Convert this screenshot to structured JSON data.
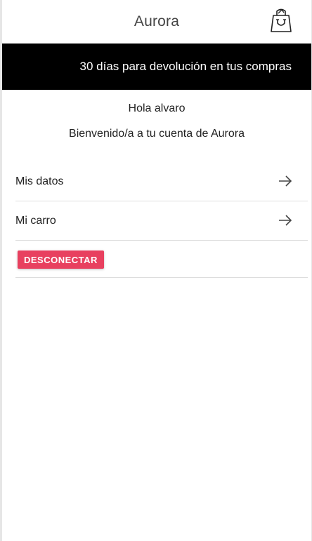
{
  "header": {
    "title": "Aurora",
    "cart_icon": "shopping-bag-icon"
  },
  "promo": {
    "text": "30 días para devolución en tus compras"
  },
  "account": {
    "greeting": "Hola alvaro",
    "welcome": "Bienvenido/a a tu cuenta de Aurora"
  },
  "menu": {
    "items": [
      {
        "label": "Mis datos",
        "icon": "arrow-right-icon"
      },
      {
        "label": "Mi carro",
        "icon": "arrow-right-icon"
      }
    ]
  },
  "logout": {
    "label": "DESCONECTAR"
  },
  "colors": {
    "banner_bg": "#000000",
    "banner_text": "#ffffff",
    "logout_bg": "#e8405f",
    "divider": "#dddddd"
  }
}
